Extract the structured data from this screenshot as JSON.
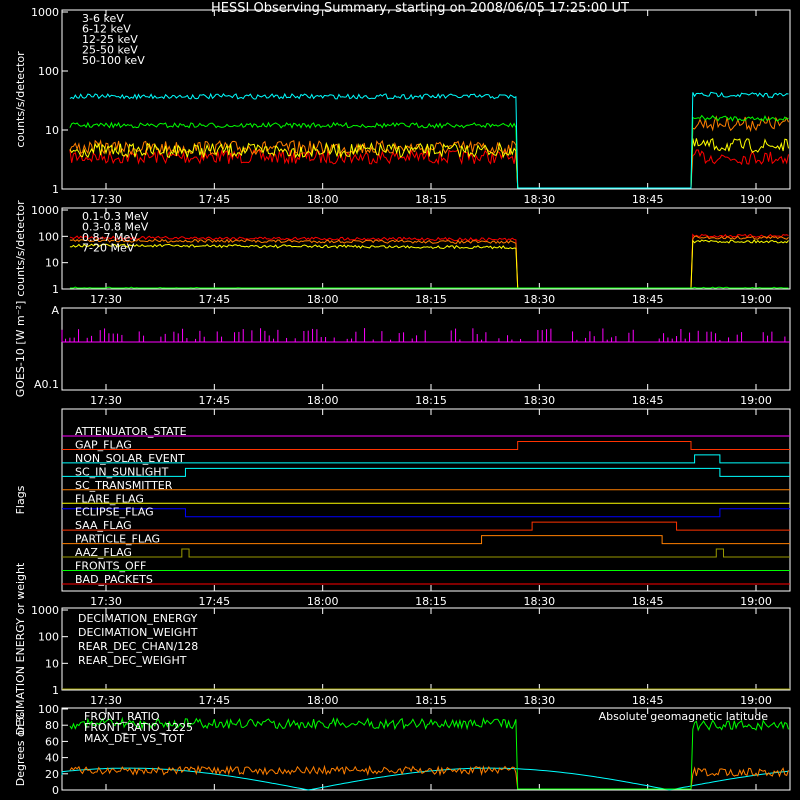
{
  "title": "HESSI Observing Summary, starting on 2008/06/05 17:25:00 UT",
  "x_ticks": [
    "17:30",
    "17:45",
    "18:00",
    "18:15",
    "18:30",
    "18:45",
    "19:00"
  ],
  "chart_data": [
    {
      "type": "line",
      "ylabel": "counts/s/detector",
      "y_scale": "log",
      "ylim": [
        1,
        1000
      ],
      "y_ticks": [
        "1000",
        "100",
        "10",
        "1"
      ],
      "gap_minutes": [
        62,
        86
      ],
      "series": [
        {
          "name": "3-6 keV",
          "color": "#ff0000",
          "before": 3.5,
          "after": 3.5
        },
        {
          "name": "6-12 keV",
          "color": "#ff7f00",
          "before": 5,
          "after": 13
        },
        {
          "name": "12-25 keV",
          "color": "#ffff00",
          "before": 4.5,
          "after": 5.5
        },
        {
          "name": "25-50 keV",
          "color": "#00ff00",
          "before": 12,
          "after": 16
        },
        {
          "name": "50-100 keV",
          "color": "#00ffff",
          "before": 37,
          "after": 40
        }
      ]
    },
    {
      "type": "line",
      "ylabel": "counts/s/detector",
      "y_scale": "log",
      "ylim": [
        1,
        1000
      ],
      "y_ticks": [
        "1000",
        "100",
        "10",
        "1"
      ],
      "gap_minutes": [
        62,
        86
      ],
      "series": [
        {
          "name": "0.1-0.3 MeV",
          "color": "#ff0000",
          "before": 90,
          "after": 105
        },
        {
          "name": "0.3-0.8 MeV",
          "color": "#ff7f00",
          "before": 70,
          "after": 90
        },
        {
          "name": "0.8-7 MeV",
          "color": "#ffff00",
          "before": 45,
          "after": 65
        },
        {
          "name": "7-20 MeV",
          "color": "#00ff00",
          "before": 1,
          "after": 1
        }
      ]
    },
    {
      "type": "line",
      "ylabel": "GOES-10 [W m⁻²]",
      "y_ticks": [
        "A",
        "A0.1"
      ],
      "series": [
        {
          "name": "",
          "color": "#ff00ff"
        }
      ]
    },
    {
      "type": "flags",
      "ylabel": "Flags",
      "flags": [
        {
          "name": "ATTENUATOR_STATE",
          "color": "#ff00ff",
          "segments": []
        },
        {
          "name": "GAP_FLAG",
          "color": "#ff3300",
          "segments": [
            [
              62,
              86
            ]
          ]
        },
        {
          "name": "NON_SOLAR_EVENT",
          "color": "#00ffff",
          "segments": [
            [
              86.5,
              90
            ]
          ]
        },
        {
          "name": "SC_IN_SUNLIGHT",
          "color": "#00ffff",
          "segments": [
            [
              -100,
              16
            ],
            [
              90,
              200
            ]
          ],
          "inverted": true
        },
        {
          "name": "SC_TRANSMITTER",
          "color": "#ff7f00",
          "segments": []
        },
        {
          "name": "FLARE_FLAG",
          "color": "#ffff00",
          "segments": []
        },
        {
          "name": "ECLIPSE_FLAG",
          "color": "#0000ff",
          "segments": [
            [
              -100,
              16
            ],
            [
              90,
              200
            ]
          ]
        },
        {
          "name": "SAA_FLAG",
          "color": "#ff3300",
          "segments": [
            [
              64,
              84
            ]
          ]
        },
        {
          "name": "PARTICLE_FLAG",
          "color": "#ff7f00",
          "segments": [
            [
              57,
              82
            ]
          ]
        },
        {
          "name": "AAZ_FLAG",
          "color": "#999900",
          "segments": [
            [
              15.5,
              16.5
            ],
            [
              89.5,
              90.5
            ]
          ]
        },
        {
          "name": "FRONTS_OFF",
          "color": "#00ff00",
          "segments": []
        },
        {
          "name": "BAD_PACKETS",
          "color": "#ff0000",
          "segments": []
        }
      ]
    },
    {
      "type": "line",
      "ylabel": "DECIMATION ENERGY or weight",
      "y_scale": "log",
      "ylim": [
        1,
        1000
      ],
      "y_ticks": [
        "1000",
        "100",
        "10",
        "1"
      ],
      "series": [
        {
          "name": "DECIMATION_ENERGY",
          "color": "#00ff00"
        },
        {
          "name": "DECIMATION_WEIGHT",
          "color": "#ff3300"
        },
        {
          "name": "REAR_DEC_CHAN/128",
          "color": "#00ffff"
        },
        {
          "name": "REAR_DEC_WEIGHT",
          "color": "#999900"
        }
      ]
    },
    {
      "type": "line",
      "ylabel": "Degrees or %",
      "ylim": [
        0,
        100
      ],
      "y_ticks": [
        "100",
        "80",
        "60",
        "40",
        "20",
        "0"
      ],
      "gap_minutes": [
        62,
        86
      ],
      "series": [
        {
          "name": "FRONT_RATIO",
          "color": "#ffffff",
          "before": 82,
          "after": 80
        },
        {
          "name": "FRONT_RATIO_1225",
          "color": "#00ff00",
          "before": 82,
          "after": 80
        },
        {
          "name": "MAX_DET_VS_TOT",
          "color": "#ff7f00",
          "before": 24,
          "after": 22
        },
        {
          "name": "Absolute geomagnetic latitude",
          "color": "#00ffff"
        }
      ]
    }
  ]
}
